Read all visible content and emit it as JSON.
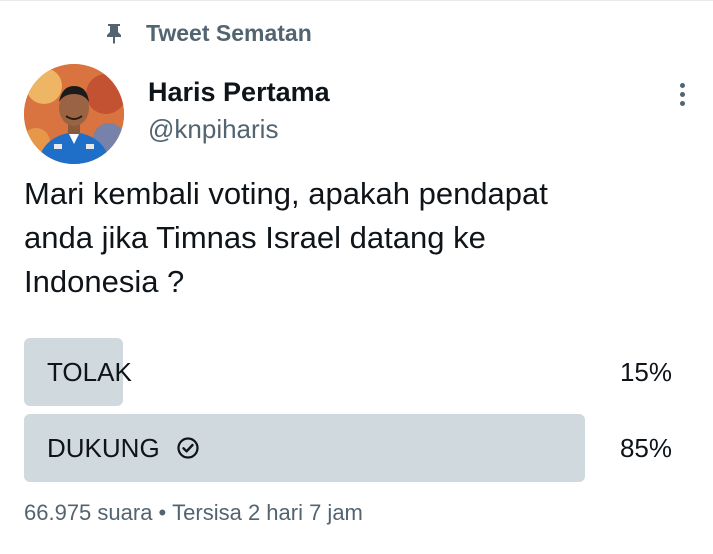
{
  "pinned": {
    "label": "Tweet Sematan",
    "icon": "pin-icon"
  },
  "author": {
    "name": "Haris Pertama",
    "handle": "@knpiharis",
    "avatar_icon": "avatar"
  },
  "tweet": {
    "text": "Mari kembali voting, apakah pendapat\nanda jika Timnas Israel datang ke\nIndonesia ?"
  },
  "poll": {
    "options": [
      {
        "label": "TOLAK",
        "percent": "15%",
        "share": 0.15,
        "selected": false
      },
      {
        "label": "DUKUNG",
        "percent": "85%",
        "share": 0.85,
        "selected": true
      }
    ],
    "votes": "66.975 suara",
    "separator": "•",
    "remaining": "Tersisa 2 hari 7 jam"
  },
  "colors": {
    "bar": "#cfd9de",
    "secondary_text": "#536471",
    "primary_text": "#0f1419"
  }
}
